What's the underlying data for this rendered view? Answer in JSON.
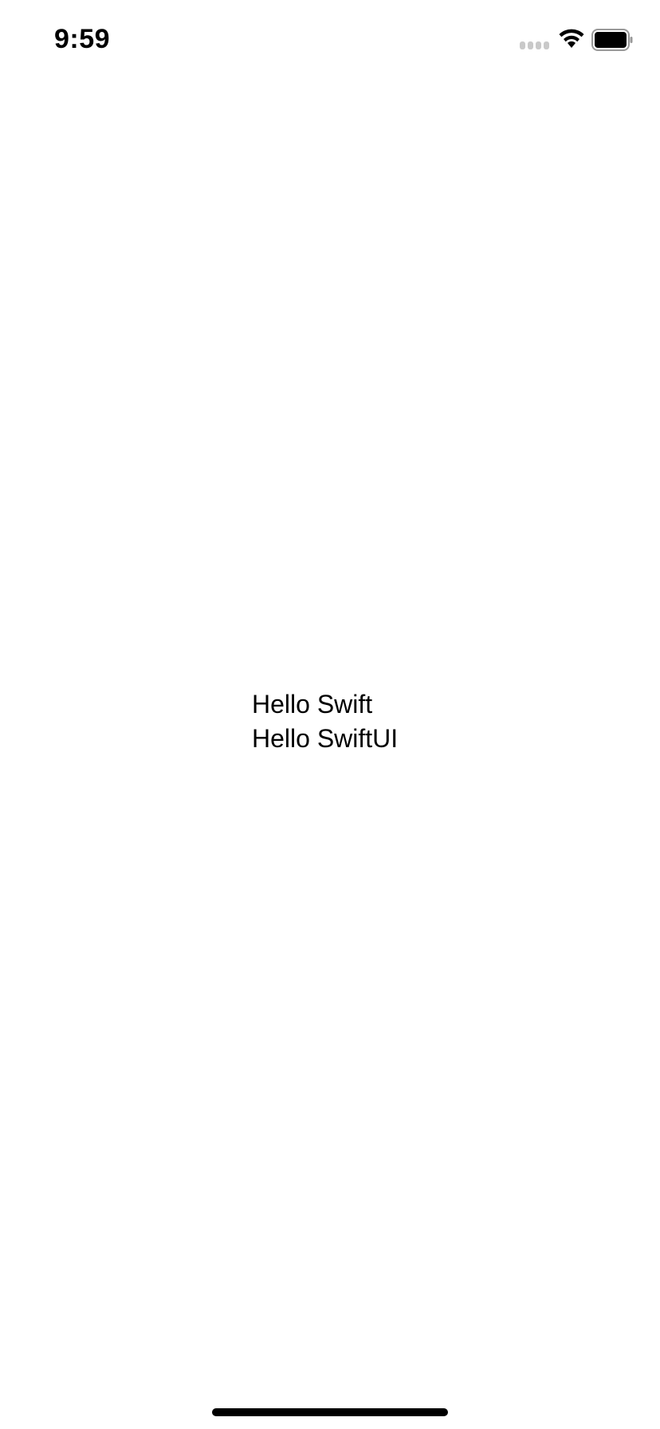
{
  "status_bar": {
    "time": "9:59",
    "signal_icon": "cellular-signal-icon",
    "wifi_icon": "wifi-icon",
    "battery_icon": "battery-icon"
  },
  "content": {
    "lines": [
      "Hello Swift",
      "Hello SwiftUI"
    ]
  },
  "colors": {
    "background": "#ffffff",
    "text": "#000000",
    "signal_inactive": "#c9c9c9"
  }
}
